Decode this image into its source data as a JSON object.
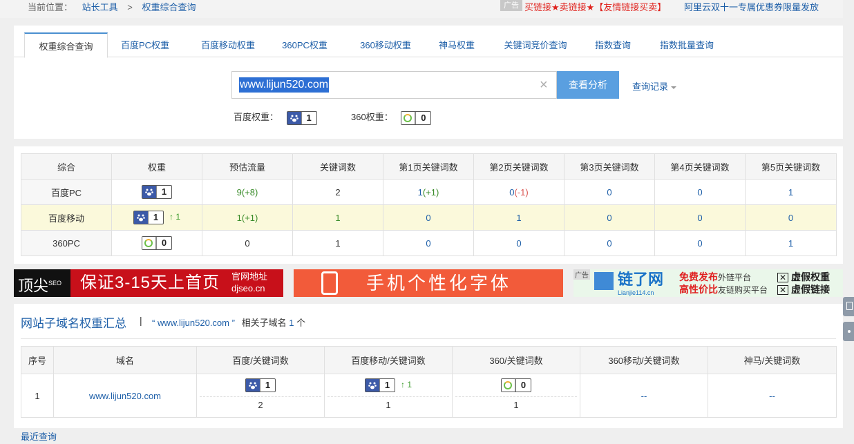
{
  "breadcrumb": {
    "prefix": "当前位置：",
    "item1": "站长工具",
    "sep": ">",
    "item2": "权重综合查询"
  },
  "topads": {
    "tag": "广告",
    "red_link": "买链接★卖链接★【友情链接买卖】",
    "blue_link": "阿里云双十一专属优惠券限量发放"
  },
  "tabs": [
    "权重综合查询",
    "百度PC权重",
    "百度移动权重",
    "360PC权重",
    "360移动权重",
    "神马权重",
    "关键词竞价查询",
    "指数查询",
    "指数批量查询"
  ],
  "search": {
    "value": "www.lijun520.com",
    "clear": "×",
    "button": "查看分析",
    "history": "查询记录"
  },
  "summary": {
    "baidu_label": "百度权重：",
    "baidu_value": "1",
    "s360_label": "360权重：",
    "s360_value": "0"
  },
  "weight_table": {
    "headers": [
      "综合",
      "权重",
      "预估流量",
      "关键词数",
      "第1页关键词数",
      "第2页关键词数",
      "第3页关键词数",
      "第4页关键词数",
      "第5页关键词数"
    ],
    "rows": [
      {
        "name": "百度PC",
        "weight": "1",
        "traffic": "9",
        "traffic_delta": "(+8)",
        "kw": "2",
        "p1": "1",
        "p1_delta": "(+1)",
        "p2": "0",
        "p2_delta": "(-1)",
        "p3": "0",
        "p4": "0",
        "p5": "1"
      },
      {
        "name": "百度移动",
        "weight": "1",
        "weight_up": "↑ 1",
        "traffic": "1",
        "traffic_delta": "(+1)",
        "kw": "1",
        "p1": "0",
        "p2": "1",
        "p3": "0",
        "p4": "0",
        "p5": "0"
      },
      {
        "name": "360PC",
        "weight": "0",
        "traffic": "0",
        "kw": "1",
        "p1": "0",
        "p2": "0",
        "p3": "0",
        "p4": "0",
        "p5": "1"
      }
    ]
  },
  "banners": {
    "b1_logo": "顶尖",
    "b1_sup": "SEO",
    "b1_text": "保证3-15天上首页",
    "b1_r1": "官网地址",
    "b1_r2": "djseo.cn",
    "b2_text": "手机个性化字体",
    "b3_tag": "广告",
    "b3_brand": "链了网",
    "b3_domain": "Lianjie114.cn",
    "b3_a1": "免费发布",
    "b3_a1s": "外链平台",
    "b3_a2": "高性价比",
    "b3_a2s": "友链购买平台",
    "b3_x1": "虚假权重",
    "b3_x2": "虚假链接"
  },
  "subdomain": {
    "title": "网站子域名权重汇总",
    "sep": "|",
    "domain_quote": "“ www.lijun520.com ”",
    "count_text": "相关子域名",
    "count": "1",
    "count_unit": "个",
    "headers": [
      "序号",
      "域名",
      "百度/关键词数",
      "百度移动/关键词数",
      "360/关键词数",
      "360移动/关键词数",
      "神马/关键词数"
    ],
    "row": {
      "idx": "1",
      "domain": "www.lijun520.com",
      "baidu_w": "1",
      "baidu_kw": "2",
      "mob_w": "1",
      "mob_up": "↑ 1",
      "mob_kw": "1",
      "s360_w": "0",
      "s360_kw": "1",
      "s360m": "--",
      "shenma": "--"
    }
  },
  "recent": "最近查询"
}
